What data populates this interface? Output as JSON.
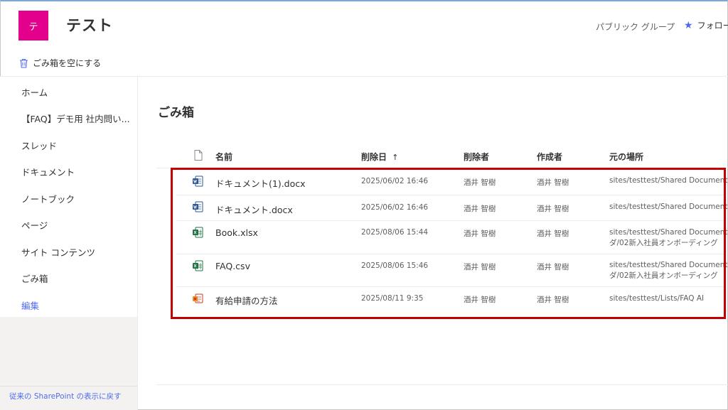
{
  "header": {
    "logo_letter": "テ",
    "site_title": "テスト",
    "group_type": "パブリック グループ",
    "follow_label": "フォロー"
  },
  "command_bar": {
    "empty_recycle_bin": "ごみ箱を空にする"
  },
  "left_nav": {
    "items": [
      {
        "label": "ホーム"
      },
      {
        "label": "【FAQ】デモ用 社内問い..."
      },
      {
        "label": "スレッド"
      },
      {
        "label": "ドキュメント"
      },
      {
        "label": "ノートブック"
      },
      {
        "label": "ページ"
      },
      {
        "label": "サイト コンテンツ"
      },
      {
        "label": "ごみ箱"
      }
    ],
    "edit_label": "編集",
    "classic_link": "従来の SharePoint の表示に戻す"
  },
  "main": {
    "title": "ごみ箱",
    "columns": {
      "name": "名前",
      "deleted_date": "削除日",
      "sort_arrow": "↑",
      "deleted_by": "削除者",
      "created_by": "作成者",
      "original_location": "元の場所"
    },
    "rows": [
      {
        "type": "word",
        "name": "ドキュメント(1).docx",
        "deleted": "2025/06/02 16:46",
        "deleted_by": "酒井 智樹",
        "created_by": "酒井 智樹",
        "location_line1": "sites/testtest/Shared Documents",
        "location_line2": ""
      },
      {
        "type": "word",
        "name": "ドキュメント.docx",
        "deleted": "2025/06/02 16:46",
        "deleted_by": "酒井 智樹",
        "created_by": "酒井 智樹",
        "location_line1": "sites/testtest/Shared Documents",
        "location_line2": ""
      },
      {
        "type": "excel",
        "name": "Book.xlsx",
        "deleted": "2025/08/06 15:44",
        "deleted_by": "酒井 智樹",
        "created_by": "酒井 智樹",
        "location_line1": "sites/testtest/Shared Documents/【テ",
        "location_line2": "ダ/02新入社員オンボーディング"
      },
      {
        "type": "excel",
        "name": "FAQ.csv",
        "deleted": "2025/08/06 15:46",
        "deleted_by": "酒井 智樹",
        "created_by": "酒井 智樹",
        "location_line1": "sites/testtest/Shared Documents/【テ",
        "location_line2": "ダ/02新入社員オンボーディング"
      },
      {
        "type": "list",
        "name": "有給申請の方法",
        "deleted": "2025/08/11 9:35",
        "deleted_by": "酒井 智樹",
        "created_by": "酒井 智樹",
        "location_line1": "sites/testtest/Lists/FAQ AI",
        "location_line2": ""
      }
    ]
  },
  "icons": {
    "word": "word-file-icon",
    "excel": "excel-file-icon",
    "list": "list-item-icon",
    "trash": "trash-icon",
    "star": "star-icon",
    "file_header": "file-type-icon"
  },
  "colors": {
    "logo": "#e3008c",
    "accent": "#4f6bed",
    "highlight": "#c00000",
    "word": "#2b579a",
    "excel": "#217346"
  }
}
